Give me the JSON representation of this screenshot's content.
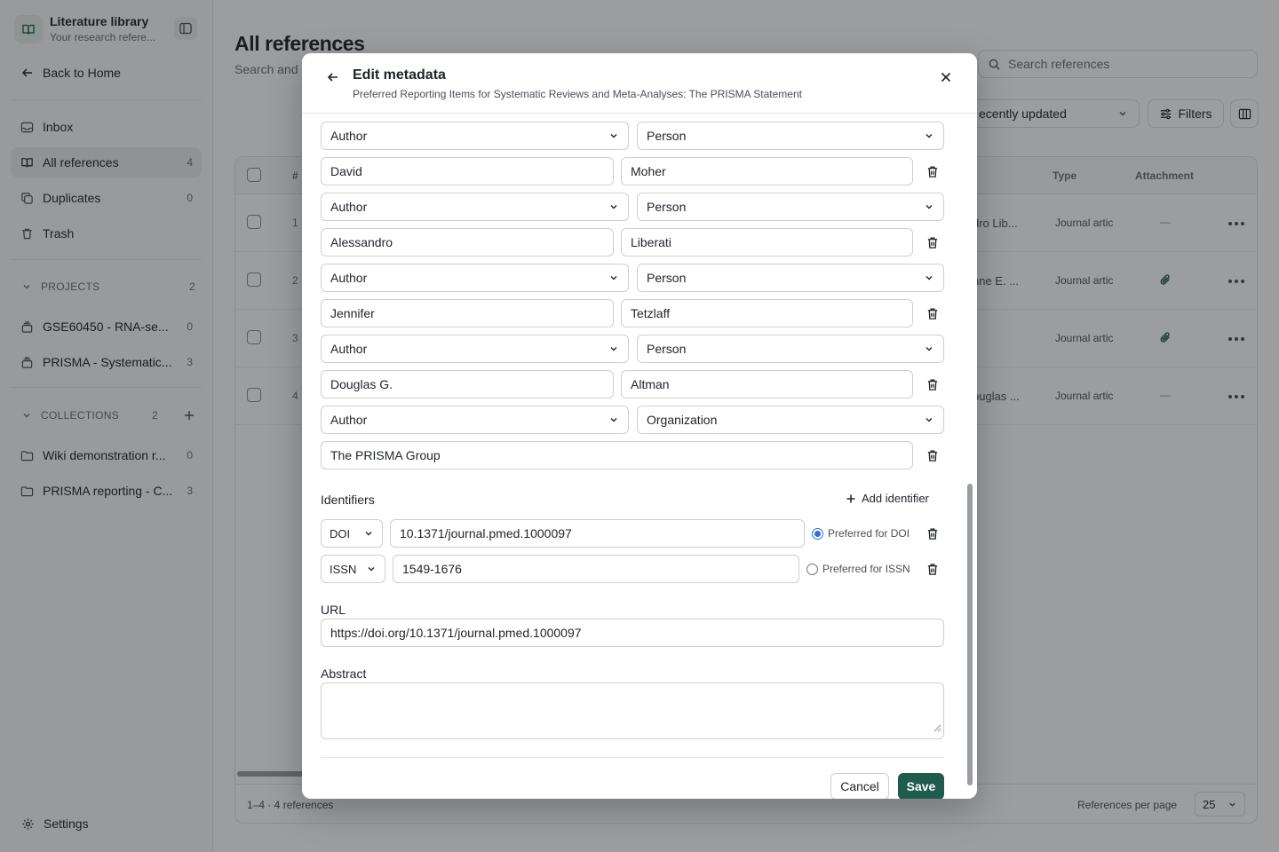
{
  "sidebar": {
    "brand_title": "Literature library",
    "brand_subtitle": "Your research refere...",
    "back_home": "Back to Home",
    "nav": [
      {
        "label": "Inbox",
        "count": ""
      },
      {
        "label": "All references",
        "count": "4"
      },
      {
        "label": "Duplicates",
        "count": "0"
      },
      {
        "label": "Trash",
        "count": ""
      }
    ],
    "projects": {
      "title": "PROJECTS",
      "count": "2",
      "items": [
        {
          "label": "GSE60450 - RNA-se...",
          "count": "0"
        },
        {
          "label": "PRISMA - Systematic...",
          "count": "3"
        }
      ]
    },
    "collections": {
      "title": "COLLECTIONS",
      "count": "2",
      "items": [
        {
          "label": "Wiki demonstration r...",
          "count": "0"
        },
        {
          "label": "PRISMA reporting - C...",
          "count": "3"
        }
      ]
    },
    "settings": "Settings"
  },
  "main": {
    "title": "All references",
    "subtitle": "Search and",
    "search_placeholder": "Search references",
    "sort_label": "ecently updated",
    "filters_label": "Filters",
    "columns": {
      "num": "#",
      "type": "Type",
      "attachment": "Attachment"
    },
    "rows": [
      {
        "num": "1",
        "authors": "dro Lib...",
        "type": "Journal artic",
        "attachment": "—"
      },
      {
        "num": "2",
        "authors": "nne E. ...",
        "type": "Journal artic",
        "attachment": "clip"
      },
      {
        "num": "3",
        "authors": "",
        "type": "Journal artic",
        "attachment": "clip"
      },
      {
        "num": "4",
        "authors": "ouglas ...",
        "type": "Journal artic",
        "attachment": "—"
      }
    ],
    "footer_range": "1–4 · 4 references",
    "per_page_label": "References per page",
    "per_page_value": "25"
  },
  "modal": {
    "title": "Edit metadata",
    "subtitle": "Preferred Reporting Items for Systematic Reviews and Meta-Analyses: The PRISMA Statement",
    "creators": [
      {
        "role": "Author",
        "kind": "Person",
        "first": "David",
        "last": "Moher"
      },
      {
        "role": "Author",
        "kind": "Person",
        "first": "Alessandro",
        "last": "Liberati"
      },
      {
        "role": "Author",
        "kind": "Person",
        "first": "Jennifer",
        "last": "Tetzlaff"
      },
      {
        "role": "Author",
        "kind": "Person",
        "first": "Douglas G.",
        "last": "Altman"
      },
      {
        "role": "Author",
        "kind": "Organization",
        "name": "The PRISMA Group"
      }
    ],
    "identifiers_label": "Identifiers",
    "add_identifier": "Add identifier",
    "identifiers": [
      {
        "type": "DOI",
        "value": "10.1371/journal.pmed.1000097",
        "preferred_label": "Preferred for DOI",
        "preferred": true
      },
      {
        "type": "ISSN",
        "value": "1549-1676",
        "preferred_label": "Preferred for ISSN",
        "preferred": false
      }
    ],
    "url_label": "URL",
    "url_value": "https://doi.org/10.1371/journal.pmed.1000097",
    "abstract_label": "Abstract",
    "abstract_value": "",
    "cancel": "Cancel",
    "save": "Save"
  },
  "colors": {
    "accent": "#1f5c4e",
    "radio_selected": "#2f6fdc",
    "overlay": "rgba(20,22,26,0.42)"
  }
}
